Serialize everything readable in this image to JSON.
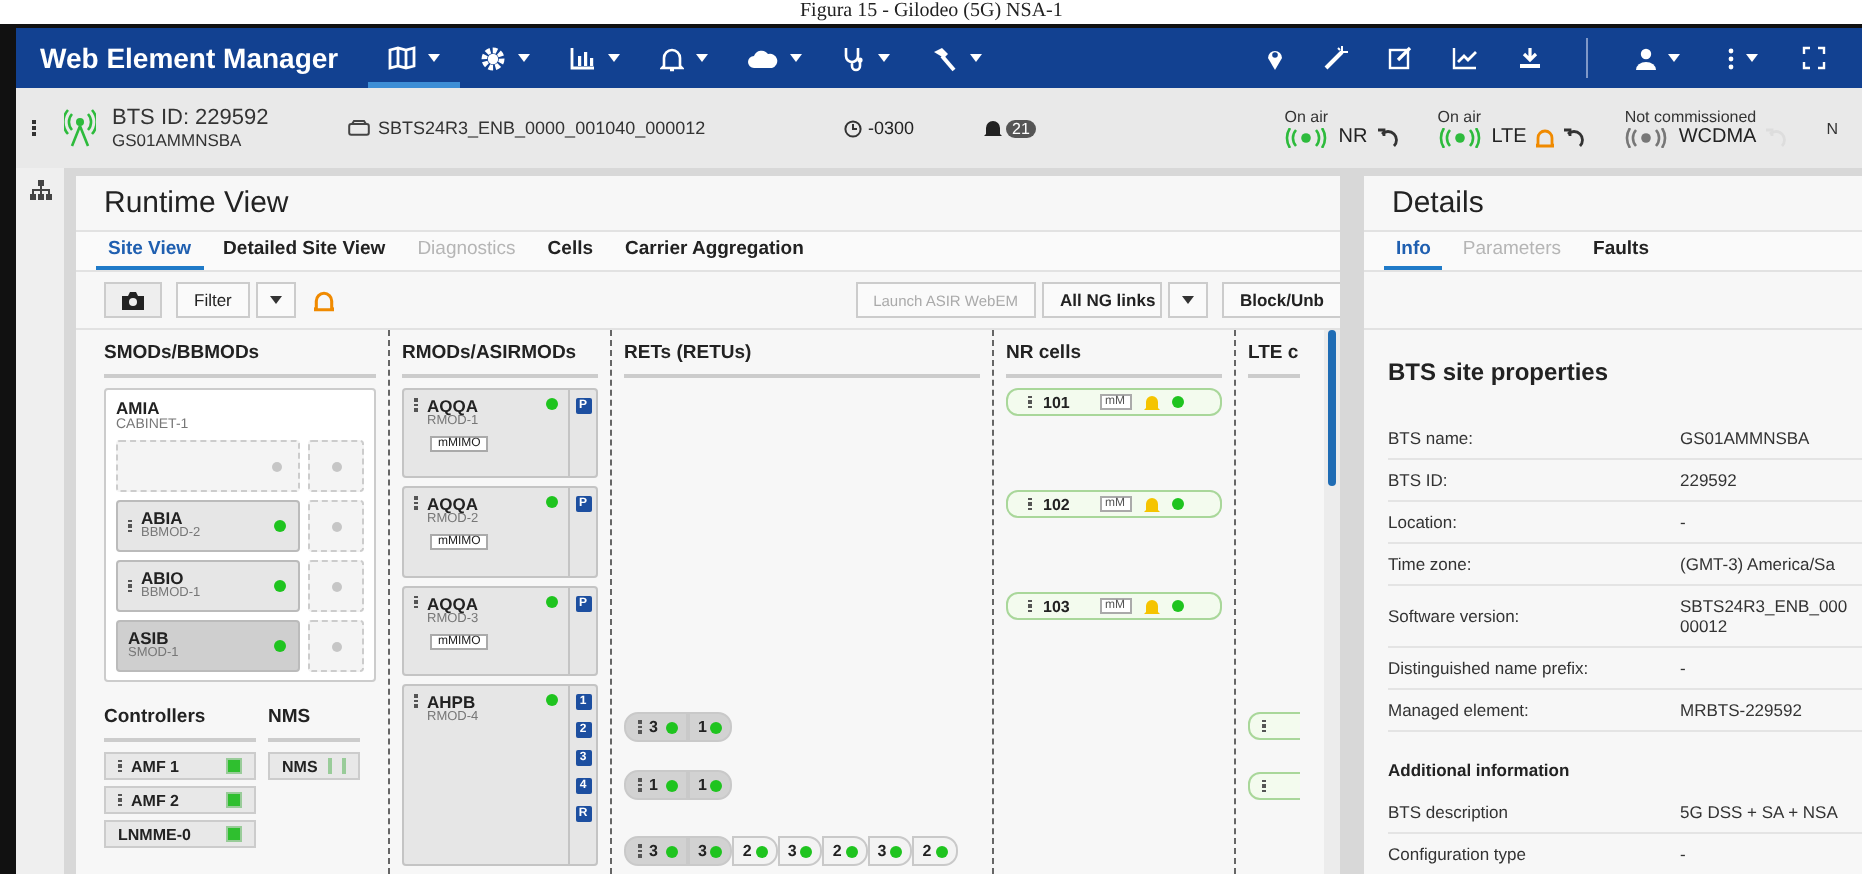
{
  "caption": "Figura 15 - Gilodeo (5G) NSA-1",
  "app": {
    "title": "Web Element Manager"
  },
  "site": {
    "bts_id": "BTS ID: 229592",
    "bts_name": "GS01AMMNSBA",
    "software": "SBTS24R3_ENB_0000_001040_000012",
    "timezone": "-0300",
    "alarm_count": "21"
  },
  "technologies": [
    {
      "status": "On air",
      "name": "NR",
      "on_air": true,
      "alarm": false
    },
    {
      "status": "On air",
      "name": "LTE",
      "on_air": true,
      "alarm": true
    },
    {
      "status": "Not commissioned",
      "name": "WCDMA",
      "on_air": false,
      "alarm": false
    },
    {
      "status": "N"
    }
  ],
  "runtime": {
    "title": "Runtime View",
    "tabs": [
      {
        "label": "Site View",
        "selected": true,
        "disabled": false
      },
      {
        "label": "Detailed Site View",
        "selected": false,
        "disabled": false
      },
      {
        "label": "Diagnostics",
        "selected": false,
        "disabled": true
      },
      {
        "label": "Cells",
        "selected": false,
        "disabled": false
      },
      {
        "label": "Carrier Aggregation",
        "selected": false,
        "disabled": false
      }
    ],
    "toolbar": {
      "filter": "Filter",
      "launch": {
        "label": "Launch ASIR WebEM",
        "disabled": true
      },
      "links": "All NG links",
      "block": "Block/Unb"
    },
    "columns": [
      "SMODs/BBMODs",
      "RMODs/ASIRMODs",
      "RETs (RETUs)",
      "NR cells",
      "LTE c"
    ],
    "cabinet": {
      "name": "AMIA",
      "id": "CABINET-1",
      "slots": [
        {
          "kind": "empty"
        },
        {
          "kind": "module",
          "name": "ABIA",
          "id": "BBMOD-2",
          "menu": true,
          "selected": false
        },
        {
          "kind": "module",
          "name": "ABIO",
          "id": "BBMOD-1",
          "menu": true,
          "selected": false
        },
        {
          "kind": "module",
          "name": "ASIB",
          "id": "SMOD-1",
          "menu": false,
          "selected": true
        }
      ]
    },
    "controllers_title": "Controllers",
    "nms_title": "NMS",
    "controllers": [
      {
        "name": "AMF 1",
        "menu": true
      },
      {
        "name": "AMF 2",
        "menu": true
      },
      {
        "name": "LNMME-0",
        "menu": false
      }
    ],
    "nms": [
      {
        "name": "NMS"
      }
    ],
    "rmods": [
      {
        "name": "AQQA",
        "id": "RMOD-1",
        "tag": "mMIMO",
        "ports": [
          "P"
        ]
      },
      {
        "name": "AQQA",
        "id": "RMOD-2",
        "tag": "mMIMO",
        "ports": [
          "P"
        ]
      },
      {
        "name": "AQQA",
        "id": "RMOD-3",
        "tag": "mMIMO",
        "ports": [
          "P"
        ]
      },
      {
        "name": "AHPB",
        "id": "RMOD-4",
        "ports": [
          "1",
          "2",
          "3",
          "4",
          "R"
        ]
      }
    ],
    "rets": [
      {
        "values": [
          "3",
          "1"
        ]
      },
      {
        "values": [
          "1",
          "1"
        ]
      },
      {
        "values": [
          "3",
          "3",
          "2",
          "3",
          "2",
          "3",
          "2"
        ]
      }
    ],
    "nr_cells": [
      {
        "id": "101",
        "tag": "mM"
      },
      {
        "id": "102",
        "tag": "mM"
      },
      {
        "id": "103",
        "tag": "mM"
      }
    ],
    "lte_cells": [
      {
        "menu": true
      },
      {
        "menu": true
      }
    ]
  },
  "details": {
    "title": "Details",
    "tabs": [
      {
        "label": "Info",
        "selected": true,
        "disabled": false
      },
      {
        "label": "Parameters",
        "selected": false,
        "disabled": true
      },
      {
        "label": "Faults",
        "selected": false,
        "disabled": false
      }
    ],
    "section": "BTS site properties",
    "properties": [
      {
        "label": "BTS name:",
        "value": [
          "GS01AMMNSBA"
        ]
      },
      {
        "label": "BTS ID:",
        "value": [
          "229592"
        ]
      },
      {
        "label": "Location:",
        "value": [
          "-"
        ]
      },
      {
        "label": "Time zone:",
        "value": [
          "(GMT-3) America/Sa"
        ]
      },
      {
        "label": "Software version:",
        "value": [
          "SBTS24R3_ENB_000",
          "00012"
        ]
      },
      {
        "label": "Distinguished name prefix:",
        "value": [
          "-"
        ]
      },
      {
        "label": "Managed element:",
        "value": [
          "MRBTS-229592"
        ]
      }
    ],
    "section2": "Additional information",
    "properties2": [
      {
        "label": "BTS description",
        "value": [
          "5G DSS + SA + NSA"
        ]
      },
      {
        "label": "Configuration type",
        "value": [
          "-"
        ]
      }
    ]
  }
}
